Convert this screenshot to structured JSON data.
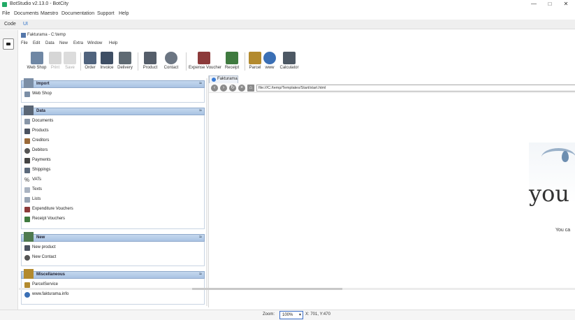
{
  "window": {
    "title": "BotStudio v2.13.0 - BotCity",
    "controls": {
      "minimize": "—",
      "maximize": "□",
      "close": "✕"
    }
  },
  "menubar": [
    "File",
    "Documents",
    "Maestro",
    "Documentation",
    "Support",
    "Help"
  ],
  "studio_tabs": [
    {
      "label": "Code",
      "active": false
    },
    {
      "label": "UI",
      "active": true
    }
  ],
  "app": {
    "title": "Fakturama - C:\\temp",
    "menu": [
      "File",
      "Edit",
      "Data",
      "New",
      "Extra",
      "Window",
      "Help"
    ],
    "toolbar": [
      {
        "label": "Web Shop",
        "icon": "cart-icon",
        "enabled": true
      },
      {
        "label": "Print",
        "icon": "printer-icon",
        "enabled": false
      },
      {
        "label": "Save",
        "icon": "save-icon",
        "enabled": false
      },
      {
        "label": "Order",
        "icon": "order-icon",
        "enabled": true
      },
      {
        "label": "Invoice",
        "icon": "invoice-icon",
        "enabled": true
      },
      {
        "label": "Delivery",
        "icon": "delivery-icon",
        "enabled": true
      },
      {
        "label": "Product",
        "icon": "product-icon",
        "enabled": true
      },
      {
        "label": "Contact",
        "icon": "contact-icon",
        "enabled": true
      },
      {
        "label": "Expense Voucher",
        "icon": "expense-voucher-icon",
        "enabled": true
      },
      {
        "label": "Receipt",
        "icon": "receipt-icon",
        "enabled": true
      },
      {
        "label": "Parcel",
        "icon": "parcel-icon",
        "enabled": true
      },
      {
        "label": "www",
        "icon": "globe-icon",
        "enabled": true
      },
      {
        "label": "Calculator",
        "icon": "calculator-icon",
        "enabled": true
      }
    ],
    "sections": [
      {
        "title": "Import",
        "icon": "cart-icon",
        "items": [
          {
            "label": "Web Shop",
            "icon": "cart-icon"
          }
        ]
      },
      {
        "title": "Data",
        "icon": "data-icon",
        "items": [
          {
            "label": "Documents",
            "icon": "documents-icon"
          },
          {
            "label": "Products",
            "icon": "products-icon"
          },
          {
            "label": "Creditors",
            "icon": "creditors-icon"
          },
          {
            "label": "Debitors",
            "icon": "debitors-icon"
          },
          {
            "label": "Payments",
            "icon": "payments-icon"
          },
          {
            "label": "Shippings",
            "icon": "shippings-icon"
          },
          {
            "label": "VATs",
            "icon": "percent-icon"
          },
          {
            "label": "Texts",
            "icon": "texts-icon"
          },
          {
            "label": "Lists",
            "icon": "lists-icon"
          },
          {
            "label": "Expenditure Vouchers",
            "icon": "expenditure-voucher-icon"
          },
          {
            "label": "Receipt Vouchers",
            "icon": "receipt-voucher-icon"
          }
        ]
      },
      {
        "title": "New",
        "icon": "new-icon",
        "items": [
          {
            "label": "New product",
            "icon": "product-icon"
          },
          {
            "label": "New Contact",
            "icon": "contact-icon"
          }
        ]
      },
      {
        "title": "Miscellaneous",
        "icon": "misc-icon",
        "items": [
          {
            "label": "ParcelService",
            "icon": "parcel-icon"
          },
          {
            "label": "www.fakturama.info",
            "icon": "globe-icon"
          }
        ]
      }
    ],
    "browser": {
      "tab_label": "Fakturama",
      "url": "file:///C:/temp/Templates/Start/start.html",
      "content_word": "you",
      "content_text": "You ca"
    }
  },
  "status": {
    "zoom_label": "Zoom:",
    "zoom_value": "100%",
    "coords": "X: 701, Y:470"
  },
  "colors": {
    "section_header": "#b7cde8",
    "accent": "#2a6ec7"
  }
}
